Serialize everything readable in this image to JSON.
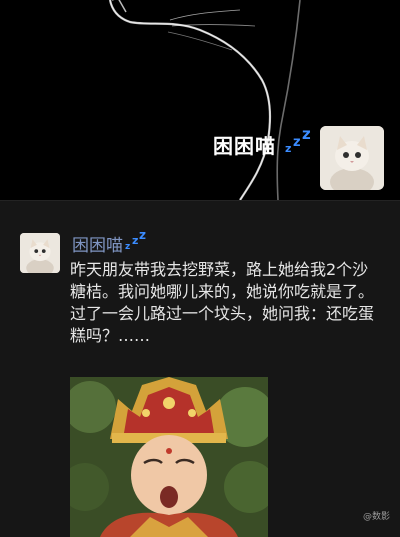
{
  "profile": {
    "name": "困困喵",
    "status_icon": "zzz-sleep-icon"
  },
  "post": {
    "author": "困困喵",
    "status_icon": "zzz-sleep-icon",
    "paragraph1": "昨天朋友带我去挖野菜，路上她给我2个沙糖桔。我问她哪儿来的，她说你吃就是了。",
    "paragraph2": "过了一会儿路过一个坟头，她问我：还吃蛋糕吗？……",
    "image": "tang-monk-meme-photo"
  },
  "watermark": "@数影",
  "colors": {
    "background": "#161616",
    "author_name": "#7f95c2",
    "zzz": "#3b8cff"
  }
}
